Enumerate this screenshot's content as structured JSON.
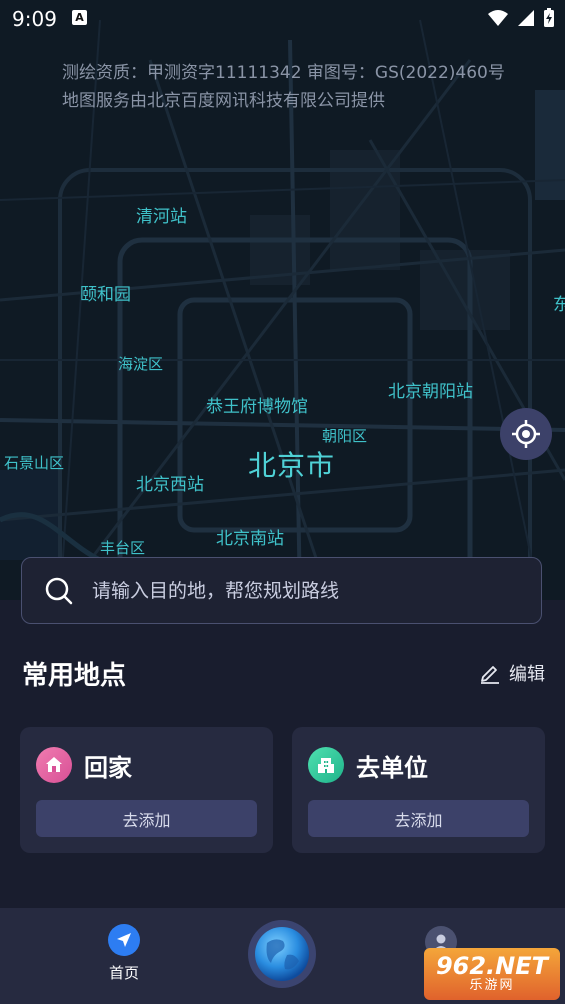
{
  "status_bar": {
    "time": "9:09",
    "a_badge": "A"
  },
  "map": {
    "attribution_line1": "测绘资质：甲测资字11111342    审图号：GS(2022)460号",
    "attribution_line2": "地图服务由北京百度网讯科技有限公司提供",
    "labels": {
      "qinghe": "清河站",
      "yiheyuan": "颐和园",
      "haidian": "海淀区",
      "gongwangfu": "恭王府博物馆",
      "chaoyang_station": "北京朝阳站",
      "chaoyang_district": "朝阳区",
      "beijing": "北京市",
      "shijingshan": "石景山区",
      "west_station": "北京西站",
      "fengtai": "丰台区",
      "south_station": "北京南站",
      "edge_east": "东"
    }
  },
  "search": {
    "placeholder": "请输入目的地，帮您规划路线"
  },
  "common_places": {
    "title": "常用地点",
    "edit_label": "编辑",
    "home": {
      "title": "回家",
      "add_label": "去添加"
    },
    "work": {
      "title": "去单位",
      "add_label": "去添加"
    }
  },
  "bottom_nav": {
    "home_label": "首页"
  },
  "watermark": {
    "line1": "962.NET",
    "line2": "乐游网"
  },
  "colors": {
    "accent_blue": "#2d7df2",
    "map_label": "#3fc1c9",
    "home_pink": "#e8609f",
    "work_green": "#2ec79a"
  }
}
